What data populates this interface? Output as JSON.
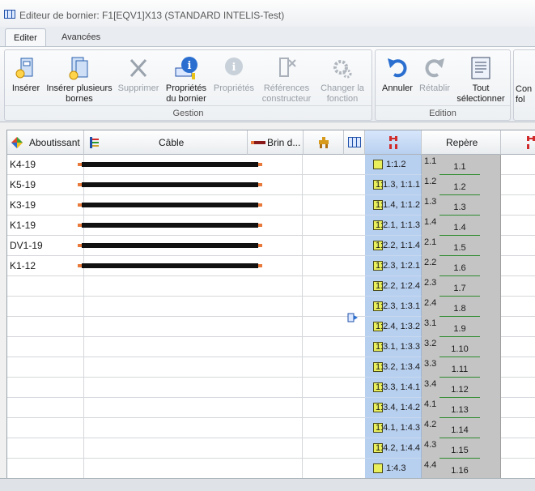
{
  "window": {
    "title": "Editeur de bornier: F1[EQV1]X13 (STANDARD INTELIS-Test)"
  },
  "tabs": [
    {
      "label": "Editer"
    },
    {
      "label": "Avancées"
    }
  ],
  "ribbon": {
    "groups": [
      {
        "label": "Gestion"
      },
      {
        "label": "Edition"
      }
    ],
    "buttons": [
      {
        "label": "Insérer",
        "icon": "insert-terminal-icon"
      },
      {
        "label": "Insérer plusieurs bornes",
        "icon": "insert-multiple-icon"
      },
      {
        "label": "Supprimer",
        "icon": "delete-icon"
      },
      {
        "label": "Propriétés du bornier",
        "icon": "strip-properties-icon"
      },
      {
        "label": "Propriétés",
        "icon": "properties-icon"
      },
      {
        "label": "Références constructeur",
        "icon": "manufacturer-ref-icon"
      },
      {
        "label": "Changer la fonction",
        "icon": "change-function-icon"
      },
      {
        "label": "Annuler",
        "icon": "undo-icon"
      },
      {
        "label": "Rétablir",
        "icon": "redo-icon"
      },
      {
        "label": "Tout sélectionner",
        "icon": "select-all-icon"
      },
      {
        "label": "Con fol",
        "icon": "config-icon"
      }
    ]
  },
  "grid": {
    "headers": {
      "aboutissant": "Aboutissant",
      "cable": "Câble",
      "brin": "Brin d...",
      "repere": "Repère"
    },
    "rows": [
      {
        "aboutissant": "K4-19",
        "borne": "1:1.2",
        "rep_top": "1.1",
        "rep_val": "1.1"
      },
      {
        "aboutissant": "K5-19",
        "borne": "1:1.3, 1:1.1",
        "rep_top": "1.2",
        "rep_val": "1.2"
      },
      {
        "aboutissant": "K3-19",
        "borne": "1:1.4, 1:1.2",
        "rep_top": "1.3",
        "rep_val": "1.3"
      },
      {
        "aboutissant": "K1-19",
        "borne": "1:2.1, 1:1.3",
        "rep_top": "1.4",
        "rep_val": "1.4"
      },
      {
        "aboutissant": "DV1-19",
        "borne": "1:2.2, 1:1.4",
        "rep_top": "2.1",
        "rep_val": "1.5"
      },
      {
        "aboutissant": "K1-12",
        "borne": "1:2.3, 1:2.1",
        "rep_top": "2.2",
        "rep_val": "1.6"
      },
      {
        "aboutissant": "",
        "borne": "1:2.2, 1:2.4",
        "rep_top": "2.3",
        "rep_val": "1.7"
      },
      {
        "aboutissant": "",
        "borne": "1:2.3, 1:3.1",
        "rep_top": "2.4",
        "rep_val": "1.8"
      },
      {
        "aboutissant": "",
        "borne": "1:2.4, 1:3.2",
        "rep_top": "3.1",
        "rep_val": "1.9"
      },
      {
        "aboutissant": "",
        "borne": "1:3.1, 1:3.3",
        "rep_top": "3.2",
        "rep_val": "1.10"
      },
      {
        "aboutissant": "",
        "borne": "1:3.2, 1:3.4",
        "rep_top": "3.3",
        "rep_val": "1.11"
      },
      {
        "aboutissant": "",
        "borne": "1:3.3, 1:4.1",
        "rep_top": "3.4",
        "rep_val": "1.12"
      },
      {
        "aboutissant": "",
        "borne": "1:3.4, 1:4.2",
        "rep_top": "4.1",
        "rep_val": "1.13"
      },
      {
        "aboutissant": "",
        "borne": "1:4.1, 1:4.3",
        "rep_top": "4.2",
        "rep_val": "1.14"
      },
      {
        "aboutissant": "",
        "borne": "1:4.2, 1:4.4",
        "rep_top": "4.3",
        "rep_val": "1.15"
      },
      {
        "aboutissant": "",
        "borne": "1:4.3",
        "rep_top": "4.4",
        "rep_val": "1.16"
      }
    ]
  },
  "colors": {
    "accent": "#b8d0f0",
    "cable": "#111111",
    "cable_end": "#e8793a",
    "terminal": "#e9ef5a",
    "repere_line": "#2e8b2e"
  }
}
